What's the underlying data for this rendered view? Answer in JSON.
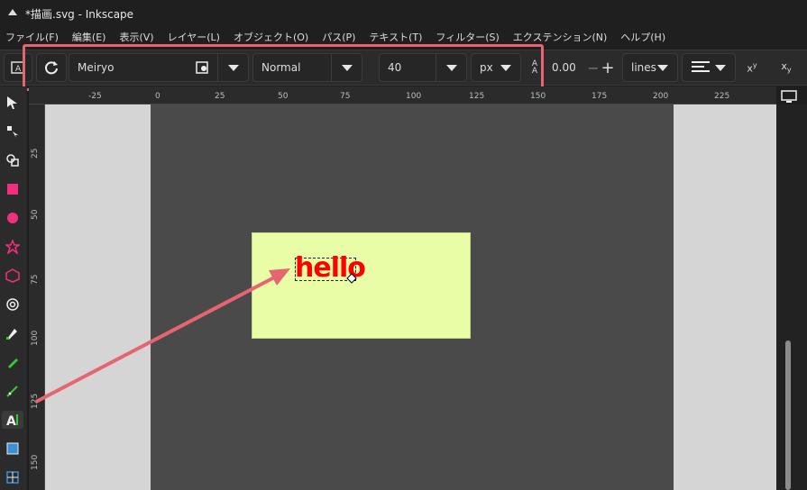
{
  "window": {
    "title": "*描画.svg - Inkscape"
  },
  "menu": [
    "ファイル(F)",
    "編集(E)",
    "表示(V)",
    "レイヤー(L)",
    "オブジェクト(O)",
    "パス(P)",
    "テキスト(T)",
    "フィルター(S)",
    "エクステンション(N)",
    "ヘルプ(H)"
  ],
  "text_toolbar": {
    "font_family": "Meiryo",
    "font_style": "Normal",
    "font_size": "40",
    "unit": "px",
    "letter_spacing": "0.00",
    "line_spacing_mode": "lines"
  },
  "ruler": {
    "top": [
      "-25",
      "0",
      "25",
      "50",
      "75",
      "100",
      "125",
      "150",
      "175",
      "200",
      "225"
    ],
    "left": [
      "25",
      "50",
      "75",
      "100",
      "125",
      "150"
    ]
  },
  "canvas": {
    "text": "hello"
  },
  "colors": {
    "highlight": "#e56672",
    "text_fill": "#ff0000",
    "rect_fill": "#e9fda6"
  }
}
